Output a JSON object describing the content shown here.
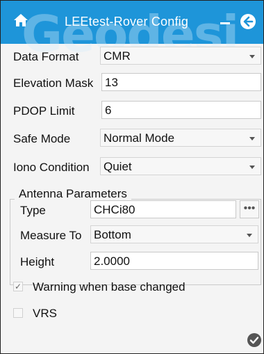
{
  "header": {
    "title": "LEEtest-Rover Config",
    "watermark": "Geodesi",
    "colors": {
      "bar": "#1e95d9",
      "icon": "#ffffff"
    },
    "icons": [
      "home-icon",
      "minimize-icon",
      "back-arrow-icon"
    ]
  },
  "form": {
    "data_format": {
      "label": "Data Format",
      "value": "CMR"
    },
    "elevation_mask": {
      "label": "Elevation Mask",
      "value": "13"
    },
    "pdop_limit": {
      "label": "PDOP Limit",
      "value": "6"
    },
    "safe_mode": {
      "label": "Safe Mode",
      "value": "Normal Mode"
    },
    "iono_condition": {
      "label": "Iono Condition",
      "value": "Quiet"
    }
  },
  "antenna": {
    "title": "Antenna Parameters",
    "type": {
      "label": "Type",
      "value": "CHCi80",
      "browse_label": "•••"
    },
    "measure_to": {
      "label": "Measure To",
      "value": "Bottom"
    },
    "height": {
      "label": "Height",
      "value": "2.0000"
    }
  },
  "options": {
    "warning_base_changed": {
      "label": "Warning when base changed",
      "checked": true,
      "mark": "✓"
    },
    "vrs": {
      "label": "VRS",
      "checked": false
    }
  },
  "footer": {
    "icons": [
      "confirm-check-icon"
    ]
  }
}
